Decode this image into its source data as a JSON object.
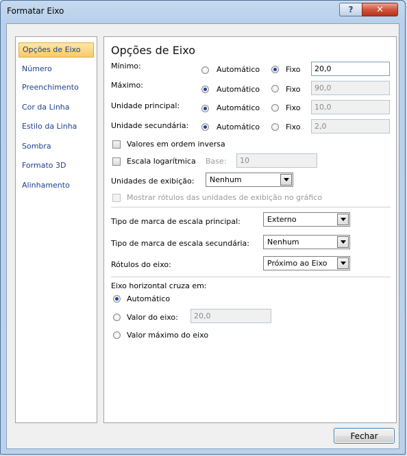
{
  "window": {
    "title": "Formatar Eixo",
    "help_glyph": "?",
    "close_glyph": "✕"
  },
  "nav": {
    "items": [
      {
        "label": "Opções de Eixo",
        "selected": true
      },
      {
        "label": "Número"
      },
      {
        "label": "Preenchimento"
      },
      {
        "label": "Cor da Linha"
      },
      {
        "label": "Estilo da Linha"
      },
      {
        "label": "Sombra"
      },
      {
        "label": "Formato 3D"
      },
      {
        "label": "Alinhamento"
      }
    ]
  },
  "panel": {
    "heading": "Opções de Eixo",
    "rows": [
      {
        "label": "Mínimo:",
        "auto_label": "Automático",
        "fixed_label": "Fixo",
        "value": "20,0",
        "selected": "fixed"
      },
      {
        "label": "Máximo:",
        "auto_label": "Automático",
        "fixed_label": "Fixo",
        "value": "90,0",
        "selected": "auto"
      },
      {
        "label": "Unidade principal:",
        "auto_label": "Automático",
        "fixed_label": "Fixo",
        "value": "10,0",
        "selected": "auto"
      },
      {
        "label": "Unidade secundária:",
        "auto_label": "Automático",
        "fixed_label": "Fixo",
        "value": "2,0",
        "selected": "auto"
      }
    ],
    "reverse_label": "Valores em ordem inversa",
    "log_label": "Escala logarítmica",
    "base_label": "Base:",
    "base_value": "10",
    "display_units_label": "Unidades de exibição:",
    "display_units_value": "Nenhum",
    "show_units_label": "Mostrar rótulos das unidades de exibição no gráfico",
    "major_tick_label": "Tipo de marca de escala principal:",
    "major_tick_value": "Externo",
    "minor_tick_label": "Tipo de marca de escala secundária:",
    "minor_tick_value": "Nenhum",
    "axis_labels_label": "Rótulos do eixo:",
    "axis_labels_value": "Próximo ao Eixo",
    "crosses_heading": "Eixo horizontal cruza em:",
    "crosses_auto": "Automático",
    "crosses_value_label": "Valor do eixo:",
    "crosses_value": "20,0",
    "crosses_max": "Valor máximo do eixo",
    "crosses_selected": "auto"
  },
  "footer": {
    "close_label": "Fechar"
  }
}
